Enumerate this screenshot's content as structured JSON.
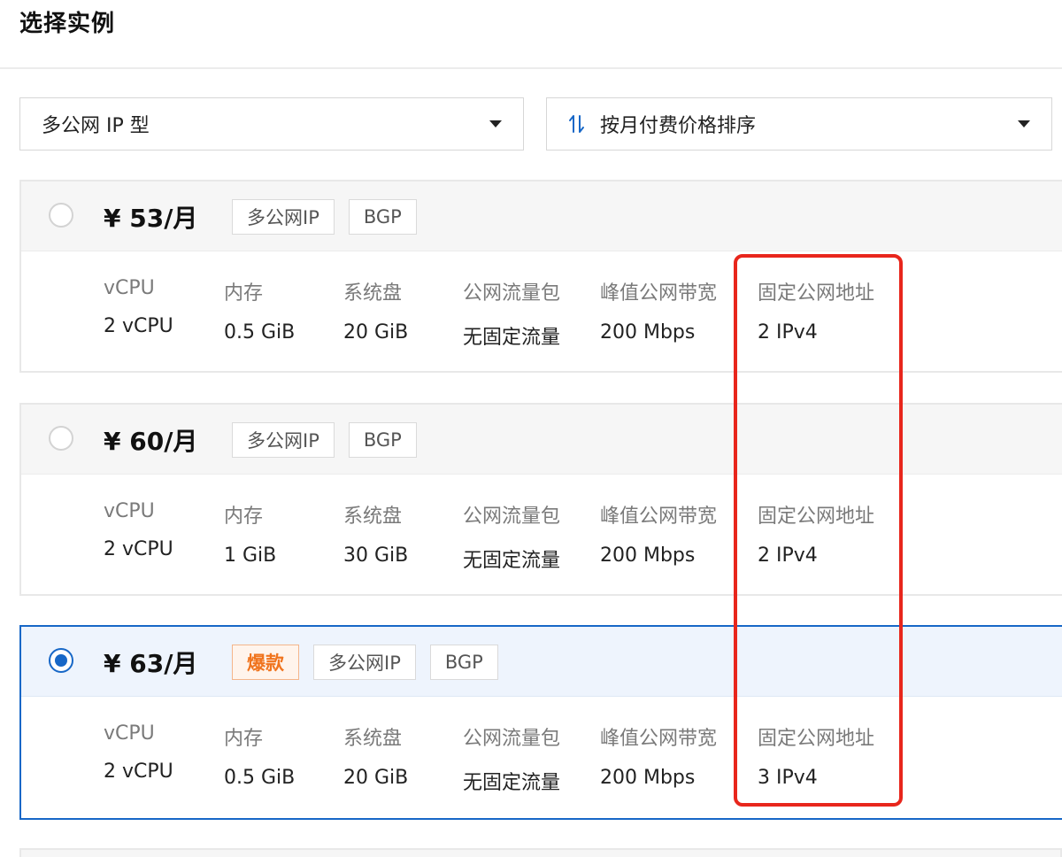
{
  "page_title": "选择实例",
  "filters": {
    "type_select": {
      "value": "多公网 IP 型"
    },
    "sort_select": {
      "value": "按月付费价格排序",
      "icon": "sort-arrows-icon"
    }
  },
  "spec_labels": [
    "vCPU",
    "内存",
    "系统盘",
    "公网流量包",
    "峰值公网带宽",
    "固定公网地址"
  ],
  "instances": [
    {
      "price": "¥ 53/月",
      "selected": false,
      "tags": [
        "多公网IP",
        "BGP"
      ],
      "specs": [
        "2 vCPU",
        "0.5 GiB",
        "20 GiB",
        "无固定流量",
        "200 Mbps",
        "2 IPv4"
      ]
    },
    {
      "price": "¥ 60/月",
      "selected": false,
      "tags": [
        "多公网IP",
        "BGP"
      ],
      "specs": [
        "2 vCPU",
        "1 GiB",
        "30 GiB",
        "无固定流量",
        "200 Mbps",
        "2 IPv4"
      ]
    },
    {
      "price": "¥ 63/月",
      "selected": true,
      "hot_tag": "爆款",
      "tags": [
        "多公网IP",
        "BGP"
      ],
      "specs": [
        "2 vCPU",
        "0.5 GiB",
        "20 GiB",
        "无固定流量",
        "200 Mbps",
        "3 IPv4"
      ]
    }
  ],
  "colors": {
    "accent": "#1767c7",
    "hot": "#f0741e",
    "highlight": "#e8261c"
  }
}
